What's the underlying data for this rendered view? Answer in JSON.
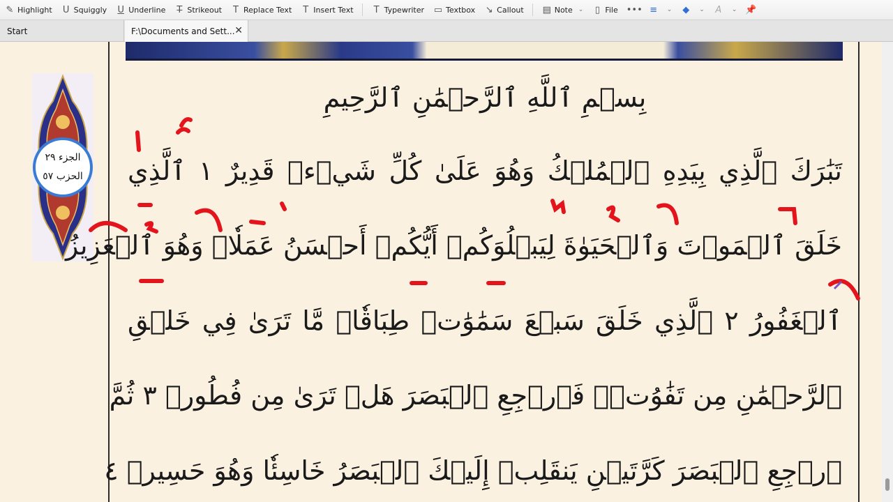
{
  "toolbar": {
    "items": [
      {
        "label": "Highlight",
        "icon": "highlight-icon"
      },
      {
        "label": "Squiggly",
        "icon": "squiggly-icon"
      },
      {
        "label": "Underline",
        "icon": "underline-icon"
      },
      {
        "label": "Strikeout",
        "icon": "strikeout-icon"
      },
      {
        "label": "Replace Text",
        "icon": "replace-text-icon"
      },
      {
        "label": "Insert Text",
        "icon": "insert-text-icon"
      },
      {
        "label": "Typewriter",
        "icon": "typewriter-icon"
      },
      {
        "label": "Textbox",
        "icon": "textbox-icon"
      },
      {
        "label": "Callout",
        "icon": "callout-icon"
      },
      {
        "label": "Note",
        "icon": "note-icon"
      },
      {
        "label": "File",
        "icon": "file-icon"
      }
    ]
  },
  "tabs": {
    "start": "Start",
    "document": "F:\\Documents and Sett..."
  },
  "juz": {
    "juz_text": "الجزء ٢٩",
    "hizb_text": "الحزب ٥٧"
  },
  "quran": {
    "basmala": "بِسۡمِ ٱللَّهِ ٱلرَّحۡمَٰنِ ٱلرَّحِيمِ",
    "lines": [
      "تَبَٰرَكَ ٱلَّذِي بِيَدِهِ ٱلۡمُلۡكُ وَهُوَ عَلَىٰ كُلِّ شَيۡءٖ قَدِيرٌ ١ ٱلَّذِي",
      "خَلَقَ ٱلۡمَوۡتَ وَٱلۡحَيَوٰةَ لِيَبۡلُوَكُمۡ أَيُّكُمۡ أَحۡسَنُ عَمَلٗاۚ وَهُوَ ٱلۡعَزِيزُ",
      "ٱلۡغَفُورُ ٢ ٱلَّذِي خَلَقَ سَبۡعَ سَمَٰوَٰتٖ طِبَاقٗاۖ مَّا تَرَىٰ فِي خَلۡقِ",
      "ٱلرَّحۡمَٰنِ مِن تَفَٰوُتٖۖ فَٱرۡجِعِ ٱلۡبَصَرَ هَلۡ تَرَىٰ مِن فُطُورٖ ٣ ثُمَّ",
      "ٱرۡجِعِ ٱلۡبَصَرَ كَرَّتَيۡنِ يَنقَلِبۡ إِلَيۡكَ ٱلۡبَصَرُ خَاسِئٗا وَهُوَ حَسِيرٞ ٤"
    ]
  },
  "colors": {
    "page_background": "#fbf1e1",
    "annotation_red": "#e3141b",
    "text": "#1a1a1a"
  }
}
